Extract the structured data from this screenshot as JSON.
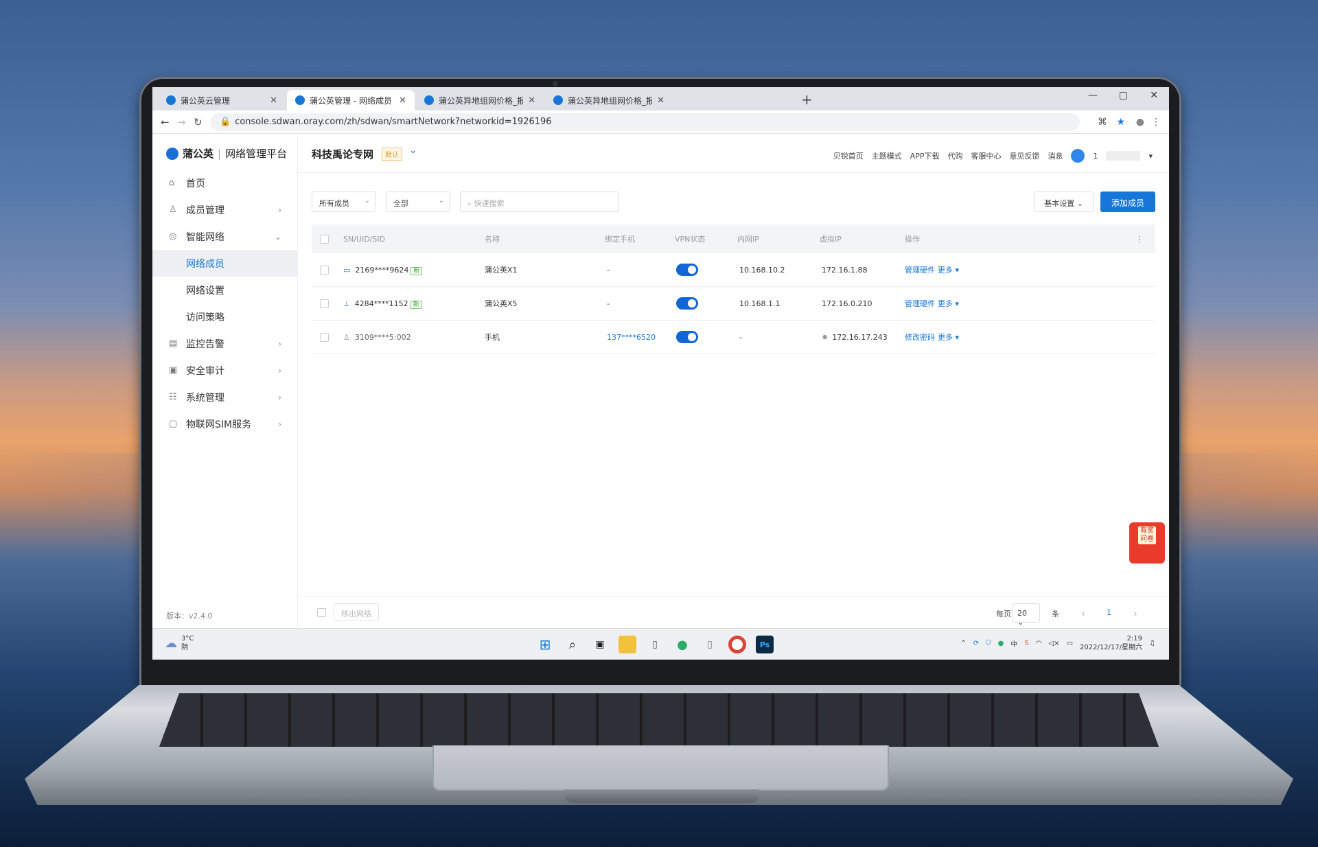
{
  "browser": {
    "tabs": [
      {
        "title": "蒲公英云管理",
        "active": false
      },
      {
        "title": "蒲公英管理 - 网络成员",
        "active": true
      },
      {
        "title": "蒲公英异地组网价格_报价_多少钱",
        "active": false
      },
      {
        "title": "蒲公英异地组网价格_报价_多少钱",
        "active": false
      }
    ],
    "url": "console.sdwan.oray.com/zh/sdwan/smartNetwork?networkid=1926196"
  },
  "sidebar": {
    "logo_brand": "蒲公英",
    "logo_sep": "|",
    "logo_platform": "网络管理平台",
    "items": [
      {
        "label": "首页",
        "icon": "home-icon"
      },
      {
        "label": "成员管理",
        "icon": "user-icon",
        "chevron": "›"
      },
      {
        "label": "智能网络",
        "icon": "network-icon",
        "chevron": "⌄"
      },
      {
        "label": "网络成员",
        "sub": true,
        "selected": true
      },
      {
        "label": "网络设置",
        "sub": true
      },
      {
        "label": "访问策略",
        "sub": true
      },
      {
        "label": "监控告警",
        "icon": "monitor-icon",
        "chevron": "›"
      },
      {
        "label": "安全审计",
        "icon": "audit-icon",
        "chevron": "›"
      },
      {
        "label": "系统管理",
        "icon": "system-icon",
        "chevron": "›"
      },
      {
        "label": "物联网SIM服务",
        "icon": "sim-icon",
        "chevron": "›"
      }
    ],
    "version": "版本：v2.4.0"
  },
  "header": {
    "network_name": "科技禹论专网",
    "default_badge": "默认",
    "links": [
      "贝锐首页",
      "主题模式",
      "APP下载",
      "代购",
      "客服中心",
      "意见反馈",
      "消息"
    ],
    "username": "1"
  },
  "filters": {
    "member_type": "所有成员",
    "status": "全部",
    "search_placeholder": "快速搜索",
    "basic_settings": "基本设置",
    "add_member": "添加成员"
  },
  "table": {
    "headers": [
      "SN/UID/SID",
      "名称",
      "绑定手机",
      "VPN状态",
      "内网IP",
      "虚拟IP",
      "操作"
    ],
    "rows": [
      {
        "id": "2169****9624",
        "badge": "新",
        "name": "蒲公英X1",
        "phone": "-",
        "lan_ip": "10.168.10.2",
        "vip": "172.16.1.88",
        "action": "管理硬件",
        "more": "更多"
      },
      {
        "id": "4284****1152",
        "badge": "新",
        "name": "蒲公英X5",
        "phone": "-",
        "lan_ip": "10.168.1.1",
        "vip": "172.16.0.210",
        "action": "管理硬件",
        "more": "更多"
      },
      {
        "id": "3109****5:002",
        "badge": "",
        "name": "手机",
        "phone": "137****6520",
        "lan_ip": "-",
        "vip": "172.16.17.243",
        "action": "修改密码",
        "more": "更多"
      }
    ]
  },
  "footer": {
    "remove_btn": "移出网络",
    "per_page_label": "每页",
    "per_page": "20",
    "unit": "条",
    "page": "1"
  },
  "float_widget": {
    "line1": "有奖",
    "line2": "问卷"
  },
  "taskbar": {
    "temp": "3°C",
    "weather": "阴",
    "time": "2:19",
    "date": "2022/12/17/星期六"
  },
  "colors": {
    "accent": "#1677d8",
    "toggle": "#1366d6"
  }
}
